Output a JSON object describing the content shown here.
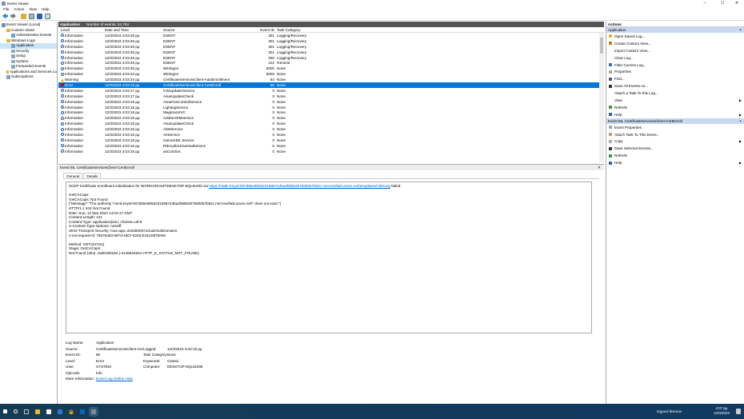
{
  "window": {
    "title": "Event Viewer",
    "controls": [
      "–",
      "☐",
      "✕"
    ]
  },
  "menu": [
    "File",
    "Action",
    "View",
    "Help"
  ],
  "tree": [
    {
      "label": "Event Viewer (Local)",
      "level": 0
    },
    {
      "label": "Custom Views",
      "level": 1
    },
    {
      "label": "Administrative Events",
      "level": 2
    },
    {
      "label": "Windows Logs",
      "level": 1
    },
    {
      "label": "Application",
      "level": 2,
      "selected": true
    },
    {
      "label": "Security",
      "level": 2
    },
    {
      "label": "Setup",
      "level": 2
    },
    {
      "label": "System",
      "level": 2
    },
    {
      "label": "Forwarded Events",
      "level": 2
    },
    {
      "label": "Applications and Services Lo",
      "level": 1
    },
    {
      "label": "Subscriptions",
      "level": 1
    }
  ],
  "list": {
    "title": "Application",
    "count": "Number of events: 24,784",
    "columns": [
      "Level",
      "Date and Time",
      "Source",
      "Event ID",
      "Task Category"
    ],
    "rows": [
      {
        "level": "Information",
        "time": "12/3/2023 4:03:46 pμ",
        "source": "ESENT",
        "id": "301",
        "task": "Logging/Recovery"
      },
      {
        "level": "Information",
        "time": "12/3/2023 4:03:46 pμ",
        "source": "ESENT",
        "id": "301",
        "task": "Logging/Recovery"
      },
      {
        "level": "Information",
        "time": "12/3/2023 4:03:46 pμ",
        "source": "ESENT",
        "id": "301",
        "task": "Logging/Recovery"
      },
      {
        "level": "Information",
        "time": "12/3/2023 4:03:46 pμ",
        "source": "ESENT",
        "id": "301",
        "task": "Logging/Recovery"
      },
      {
        "level": "Information",
        "time": "12/3/2023 4:03:46 pμ",
        "source": "ESENT",
        "id": "300",
        "task": "Logging/Recovery"
      },
      {
        "level": "Information",
        "time": "12/3/2023 4:03:46 pμ",
        "source": "ESENT",
        "id": "102",
        "task": "General"
      },
      {
        "level": "Information",
        "time": "12/3/2023 4:03:46 pμ",
        "source": "Winlogon",
        "id": "6000",
        "task": "None"
      },
      {
        "level": "Information",
        "time": "12/3/2023 4:03:43 pμ",
        "source": "Winlogon",
        "id": "6003",
        "task": "None"
      },
      {
        "level": "Warning",
        "time": "12/3/2023 4:03:34 pμ",
        "source": "CertificateServicesClient-AutoEnrollment",
        "id": "64",
        "task": "None"
      },
      {
        "level": "Error",
        "time": "12/3/2023 4:03:19 pμ",
        "source": "CertificateServicesClient-CertEnroll",
        "id": "86",
        "task": "None",
        "selected": true
      },
      {
        "level": "Information",
        "time": "12/3/2023 4:03:17 pμ",
        "source": "CWUpdaterService",
        "id": "0",
        "task": "None"
      },
      {
        "level": "Information",
        "time": "12/3/2023 4:03:17 pμ",
        "source": "AsusUpdateCheck",
        "id": "0",
        "task": "None"
      },
      {
        "level": "Information",
        "time": "12/3/2023 4:03:16 pμ",
        "source": "AsusFanControlService",
        "id": "0",
        "task": "None"
      },
      {
        "level": "Information",
        "time": "12/3/2023 4:03:16 pμ",
        "source": "LightingService",
        "id": "0",
        "task": "None"
      },
      {
        "level": "Information",
        "time": "12/3/2023 4:03:16 pμ",
        "source": "MagicianSVC",
        "id": "0",
        "task": "None"
      },
      {
        "level": "Information",
        "time": "12/3/2023 4:03:16 pμ",
        "source": "AdobeARMservice",
        "id": "0",
        "task": "None"
      },
      {
        "level": "Information",
        "time": "12/3/2023 4:03:16 pμ",
        "source": "AsusUpdateCheck",
        "id": "0",
        "task": "None"
      },
      {
        "level": "Information",
        "time": "12/3/2023 4:03:16 pμ",
        "source": "AiIMService",
        "id": "0",
        "task": "None"
      },
      {
        "level": "Information",
        "time": "12/3/2023 4:03:16 pμ",
        "source": "AIIService",
        "id": "0",
        "task": "None"
      },
      {
        "level": "Information",
        "time": "12/3/2023 4:03:16 pμ",
        "source": "GameSDK Service",
        "id": "0",
        "task": "None"
      },
      {
        "level": "Information",
        "time": "12/3/2023 4:03:16 pμ",
        "source": "RtkAudioUniversalService",
        "id": "0",
        "task": "None"
      },
      {
        "level": "Information",
        "time": "12/3/2023 4:03:16 pμ",
        "source": "asComSvc",
        "id": "0",
        "task": "None"
      }
    ]
  },
  "detail": {
    "title": "Event 86, CertificateServicesClient-CertEnroll",
    "tabs": [
      "General",
      "Details"
    ],
    "message_lines": [
      "SCEP Certificate enrollment initialization for WORKGROUP\\DESKTOP-8QL8U0I5 via ",
      "",
      "GetCACaps",
      "GetCACaps: Not Found",
      "{\"Message\":\"The authority \\\"amd-keyid-907d65e9b5623159974d5ad086b2b7580057b92c.microsoftaik.azure.net\\\" does not exist.\"}",
      "HTTP/1.1 404 Not Found",
      "Date: Sun, 12 Mar 2023 14:03:17 GMT",
      "Content-Length: 121",
      "Content-Type: application/json; charset=utf-8",
      "X-Content-Type-Options: nosniff",
      "Strict-Transport-Security: max-age=31536000;includeSubDomains",
      "x-ms-request-id: 78675dd3-897d-4d07-820d-b16135f78e92",
      "",
      "Method: GET(347ms)",
      "Stage: GetCACaps",
      "Not Found (404). 0x80190194 (-2145844844 HTTP_E_STATUS_NOT_FOUND)"
    ],
    "url": "https://AMD-KeyId-907d65e9b5623159974d5ad086b2b7580057b92c.microsoftaik.azure.net/templates/Aik/scep",
    "url_suffix": " failed:",
    "props": {
      "log_name_label": "Log Name:",
      "log_name": "Application",
      "source_label": "Source:",
      "source": "CertificateServicesClient-Cer",
      "logged_label": "Logged:",
      "logged": "12/3/2023 4:03:19 pμ",
      "event_id_label": "Event ID:",
      "event_id": "86",
      "task_label": "Task Category:",
      "task": "None",
      "level_label": "Level:",
      "level": "Error",
      "keywords_label": "Keywords:",
      "keywords": "Classic",
      "user_label": "User:",
      "user": "SYSTEM",
      "computer_label": "Computer:",
      "computer": "DESKTOP-8QL8U0I5",
      "opcode_label": "OpCode:",
      "opcode": "Info",
      "more_label": "More Information:",
      "more_link": "Event Log Online Help"
    }
  },
  "actions": {
    "title": "Actions",
    "sections": [
      {
        "title": "Application",
        "items": [
          {
            "label": "Open Saved Log...",
            "icon": "folder",
            "color": "#e6b422"
          },
          {
            "label": "Create Custom View...",
            "icon": "filter",
            "color": "#c08a00"
          },
          {
            "label": "Import Custom View...",
            "icon": "none"
          },
          {
            "label": "Clear Log...",
            "icon": "none"
          },
          {
            "label": "Filter Current Log...",
            "icon": "filter",
            "color": "#3a70b0"
          },
          {
            "label": "Properties",
            "icon": "properties",
            "color": "#9aa"
          },
          {
            "label": "Find...",
            "icon": "find",
            "color": "#557"
          },
          {
            "label": "Save All Events As...",
            "icon": "save",
            "color": "#333"
          },
          {
            "label": "Attach a Task To this Log...",
            "icon": "none"
          },
          {
            "label": "View",
            "icon": "none",
            "submenu": true
          },
          {
            "label": "Refresh",
            "icon": "refresh",
            "color": "#3a9a3a"
          },
          {
            "label": "Help",
            "icon": "help",
            "color": "#2a5fb0",
            "submenu": true
          }
        ]
      },
      {
        "title": "Event 86, CertificateServicesClient-CertEnroll",
        "items": [
          {
            "label": "Event Properties",
            "icon": "properties",
            "color": "#9aa"
          },
          {
            "label": "Attach Task To This Event...",
            "icon": "task",
            "color": "#b98"
          },
          {
            "label": "Copy",
            "icon": "copy",
            "color": "#aab",
            "submenu": true
          },
          {
            "label": "Save Selected Events...",
            "icon": "save",
            "color": "#333"
          },
          {
            "label": "Refresh",
            "icon": "refresh",
            "color": "#3a9a3a"
          },
          {
            "label": "Help",
            "icon": "help",
            "color": "#2a5fb0",
            "submenu": true
          }
        ]
      }
    ]
  },
  "taskbar": {
    "language": "Ιαχρονί δεικτών",
    "time": "4:07 pμ",
    "date": "12/3/2023"
  },
  "colors": {
    "selection": "#0078d7",
    "header": "#555555",
    "section": "#c8d8ef",
    "taskbar": "#163b55"
  }
}
